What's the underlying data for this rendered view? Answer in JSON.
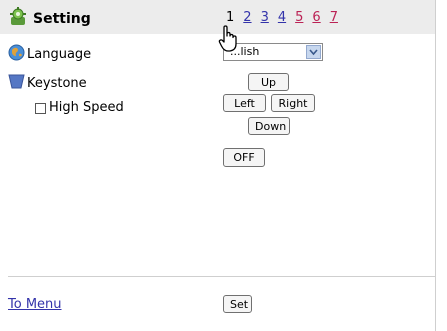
{
  "header": {
    "title": "Setting",
    "pages": [
      "1",
      "2",
      "3",
      "4",
      "5",
      "6",
      "7"
    ],
    "current_page": "1",
    "icon": "setting-gear-icon"
  },
  "language": {
    "label": "Language",
    "icon": "globe-icon",
    "select_value": "...lish"
  },
  "keystone": {
    "label": "Keystone",
    "icon": "keystone-trapezoid-icon",
    "high_speed_label": "High Speed",
    "high_speed_checked": false,
    "up": "Up",
    "left": "Left",
    "right": "Right",
    "down": "Down"
  },
  "toggle": {
    "label": "OFF"
  },
  "footer": {
    "menu_link": "To Menu",
    "set_label": "Set"
  },
  "colors": {
    "header_band": "#ececec",
    "link": "#3333aa",
    "visited_link": "#bb2255"
  }
}
